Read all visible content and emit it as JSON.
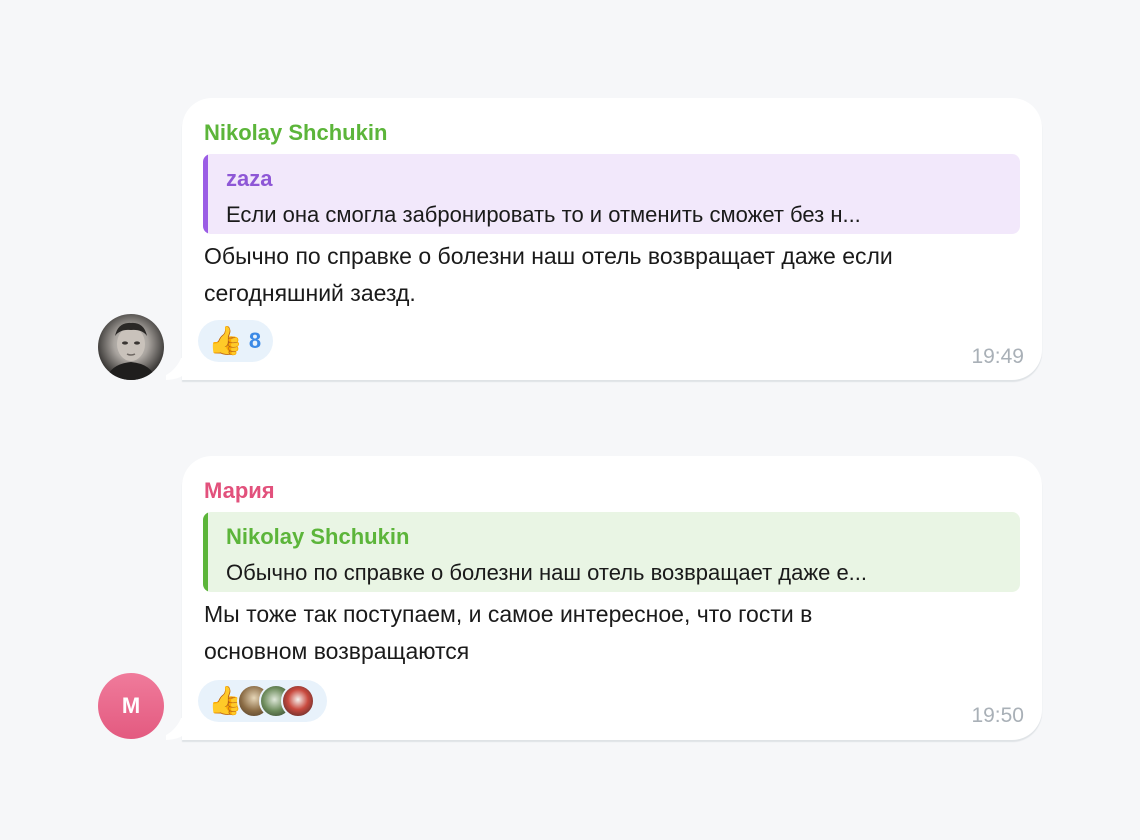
{
  "messages": [
    {
      "sender": "Nikolay Shchukin",
      "sender_color": "#5cb53a",
      "avatar_kind": "photo",
      "reply": {
        "author": "zaza",
        "author_color": "#8e57d6",
        "bar_color": "#9b5de5",
        "background": "#f2e8fb",
        "text": "Если она смогла забронировать то и отменить сможет без н..."
      },
      "text_line1": "Обычно по справке о болезни наш отель возвращает даже если",
      "text_line2": "сегодняшний заезд.",
      "reaction_emoji": "👍",
      "reaction_count": "8",
      "time": "19:49"
    },
    {
      "sender": "Мария",
      "sender_color": "#e2517c",
      "avatar_kind": "initial",
      "avatar_initial": "M",
      "reply": {
        "author": "Nikolay Shchukin",
        "author_color": "#5cb53a",
        "bar_color": "#5cb53a",
        "background": "#e9f5e4",
        "text": "Обычно по справке о болезни наш отель возвращает даже е..."
      },
      "text_line1": "Мы тоже так поступаем, и самое интересное, что гости в",
      "text_line2": "основном возвращаются",
      "reaction_emoji": "👍",
      "time": "19:50"
    }
  ]
}
